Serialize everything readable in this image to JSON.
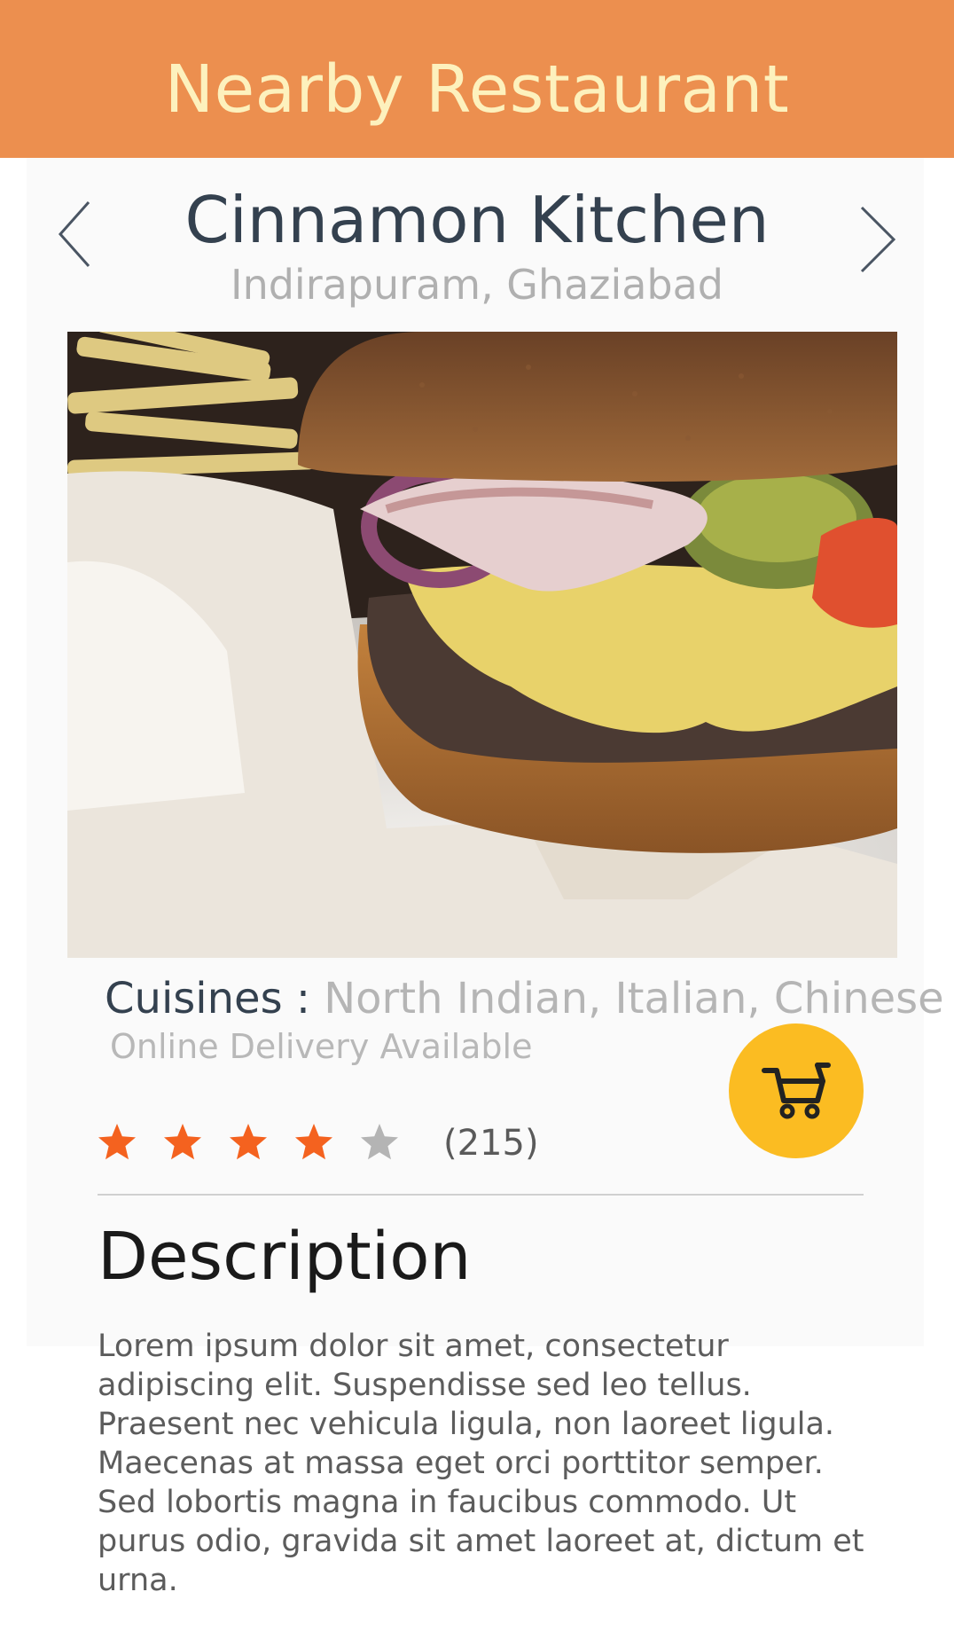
{
  "header": {
    "title": "Nearby Restaurant",
    "background": "#ec8f4f",
    "title_color": "#fdf1bd"
  },
  "restaurant": {
    "name": "Cinnamon Kitchen",
    "location": "Indirapuram, Ghaziabad",
    "cuisines_label": "Cuisines : ",
    "cuisines_value": "North Indian, Italian, Chinese",
    "delivery": "Online Delivery Available",
    "rating": 4,
    "rating_max": 5,
    "rating_count": "(215)"
  },
  "icons": {
    "prev": "chevron-left-icon",
    "next": "chevron-right-icon",
    "cart": "shopping-cart-icon",
    "star": "star-icon"
  },
  "colors": {
    "star_active": "#f4621f",
    "star_inactive": "#b4b4b4",
    "cart_button": "#fbbc22"
  },
  "description": {
    "title": "Description",
    "body": "Lorem ipsum dolor sit amet, consectetur adipiscing elit. Suspendisse sed leo tellus. Praesent nec vehicula ligula, non laoreet ligula. Maecenas at massa eget orci porttitor semper. Sed lobortis magna in faucibus commodo. Ut purus odio, gravida sit amet laoreet at, dictum et urna."
  }
}
